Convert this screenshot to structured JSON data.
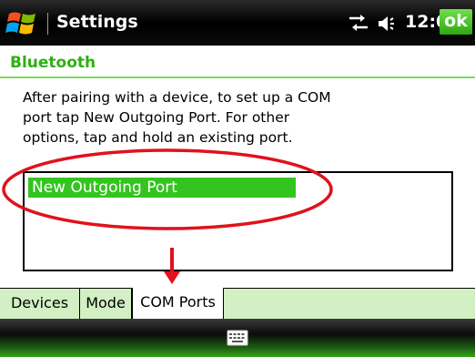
{
  "titlebar": {
    "title": "Settings",
    "clock": "12:00",
    "ok_label": "ok",
    "icons": [
      "windows-start-icon",
      "connectivity-icon",
      "volume-icon"
    ]
  },
  "section": {
    "title": "Bluetooth"
  },
  "instructions": {
    "line1": "After pairing with a device, to set up a COM",
    "line2": "port tap New Outgoing Port. For other",
    "line3": "options, tap and hold an existing port."
  },
  "port_list": {
    "items": [
      "New Outgoing Port"
    ],
    "selected_index": 0
  },
  "tabs": [
    {
      "label": "Devices",
      "active": false
    },
    {
      "label": "Mode",
      "active": false
    },
    {
      "label": "COM Ports",
      "active": true
    }
  ],
  "menubar": {
    "icons": [
      "keyboard-icon"
    ]
  },
  "colors": {
    "accent_green": "#33c41f",
    "header_green": "#2eb012",
    "tab_inactive": "#d2f0c3",
    "annotation_red": "#e0121b"
  }
}
